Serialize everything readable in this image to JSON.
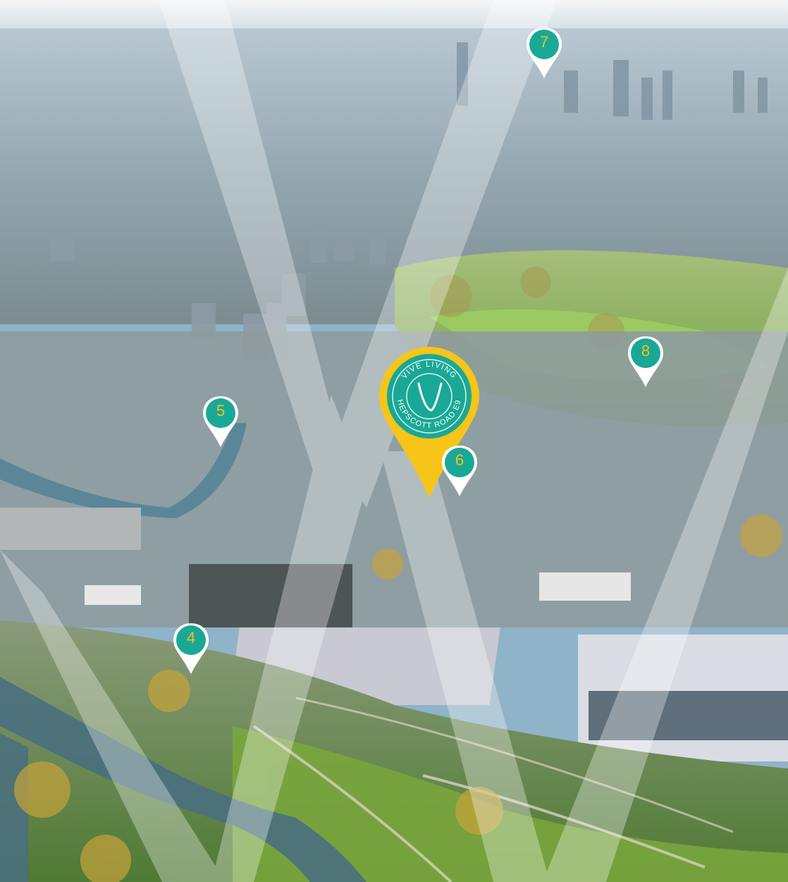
{
  "map": {
    "description_colors": {
      "sky": "#dfe9ee",
      "city": "#9fb2c0",
      "park": "#8ec45a",
      "water": "#4f7f93",
      "beam": "#ffffff"
    },
    "main_marker": {
      "brand": "VIVE LIVING",
      "address": "HEPSCOTT ROAD E9",
      "ring_color": "#1aa896",
      "pin_color": "#f6c518",
      "icon": "v-logo-icon"
    },
    "markers": [
      {
        "label": "7",
        "color": "#1aa896",
        "text_color": "#f3c21a"
      },
      {
        "label": "8",
        "color": "#1aa896",
        "text_color": "#f3c21a"
      },
      {
        "label": "5",
        "color": "#1aa896",
        "text_color": "#f3c21a"
      },
      {
        "label": "6",
        "color": "#1aa896",
        "text_color": "#f3c21a"
      },
      {
        "label": "4",
        "color": "#1aa896",
        "text_color": "#f3c21a"
      }
    ]
  }
}
